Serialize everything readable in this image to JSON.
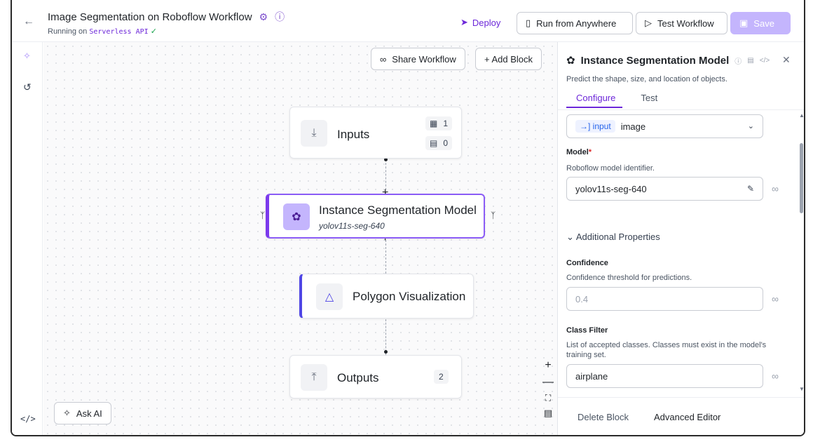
{
  "header": {
    "back_icon": "arrow-left-icon",
    "title": "Image Segmentation on Roboflow Workflow",
    "running_prefix": "Running on",
    "running_target": "Serverless API",
    "deploy_label": "Deploy",
    "run_anywhere_label": "Run from Anywhere",
    "test_workflow_label": "Test Workflow",
    "save_label": "Save"
  },
  "canvas": {
    "share_label": "Share Workflow",
    "add_block_label": "+ Add Block",
    "ask_ai_label": "Ask AI",
    "nodes": {
      "inputs": {
        "label": "Inputs",
        "image_count": "1",
        "param_count": "0"
      },
      "segmentation": {
        "label": "Instance Segmentation Model",
        "model": "yolov11s-seg-640"
      },
      "polygon": {
        "label": "Polygon Visualization"
      },
      "outputs": {
        "label": "Outputs",
        "count": "2"
      }
    }
  },
  "panel": {
    "title": "Instance Segmentation Model",
    "description": "Predict the shape, size, and location of objects.",
    "tabs": [
      "Configure",
      "Test"
    ],
    "input_tag": "input",
    "input_value": "image",
    "model_label": "Model",
    "model_help": "Roboflow model identifier.",
    "model_value": "yolov11s-seg-640",
    "additional_label": "Additional Properties",
    "confidence_label": "Confidence",
    "confidence_help": "Confidence threshold for predictions.",
    "confidence_placeholder": "0.4",
    "class_filter_label": "Class Filter",
    "class_filter_help": "List of accepted classes. Classes must exist in the model's training set.",
    "class_filter_value": "airplane",
    "delete_label": "Delete Block",
    "advanced_label": "Advanced Editor"
  },
  "colors": {
    "accent": "#6d28d9",
    "save_bg": "#c4b5fd",
    "selected_border": "#8b5cf6"
  }
}
